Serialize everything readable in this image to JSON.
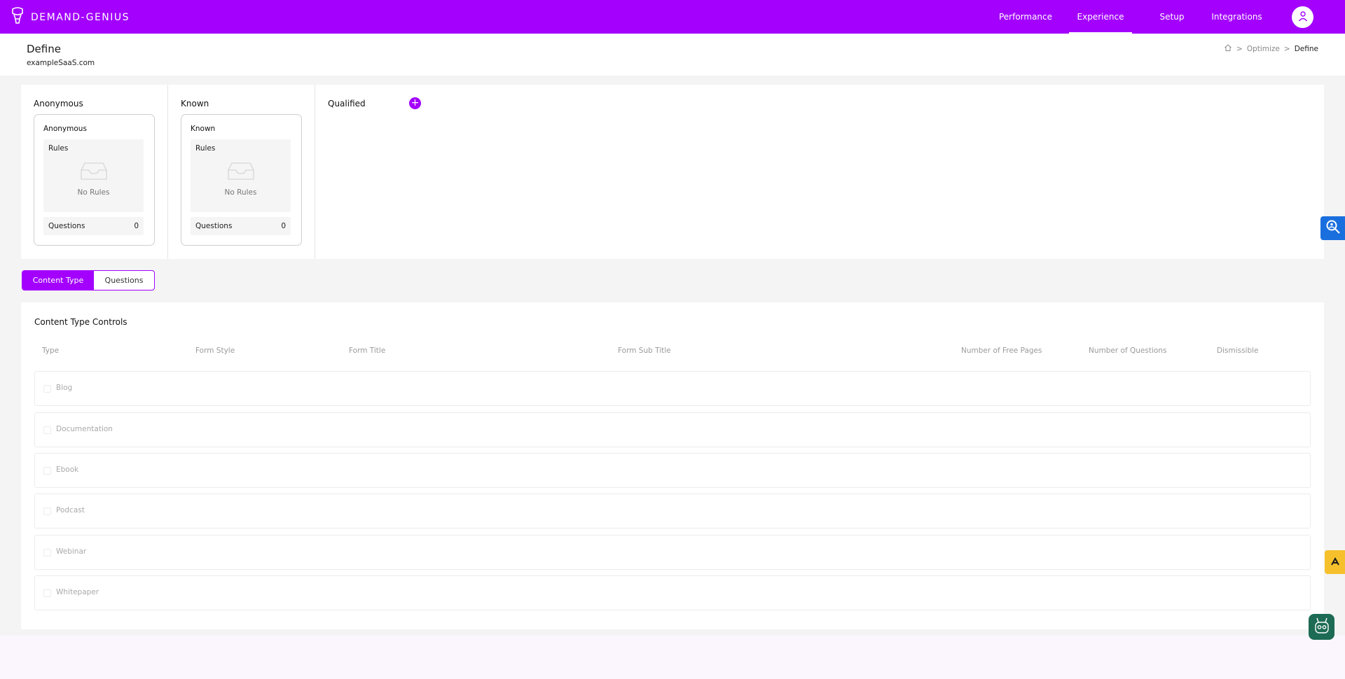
{
  "app": {
    "logo_text": "DEMAND-GENIUS"
  },
  "nav": {
    "items": [
      {
        "label": "Performance",
        "active": false
      },
      {
        "label": "Experience",
        "active": true
      },
      {
        "label": "Setup",
        "active": false
      },
      {
        "label": "Integrations",
        "active": false
      }
    ]
  },
  "header": {
    "title": "Define",
    "subtitle": "exampleSaaS.com",
    "breadcrumb": [
      "Optimize",
      "Define"
    ]
  },
  "segments": [
    {
      "heading": "Anonymous",
      "card_title": "Anonymous",
      "rules_label": "Rules",
      "empty_text": "No Rules",
      "questions_label": "Questions",
      "questions_count": "0"
    },
    {
      "heading": "Known",
      "card_title": "Known",
      "rules_label": "Rules",
      "empty_text": "No Rules",
      "questions_label": "Questions",
      "questions_count": "0"
    },
    {
      "heading": "Qualified"
    }
  ],
  "tabs": [
    {
      "label": "Content Type",
      "active": true
    },
    {
      "label": "Questions",
      "active": false
    }
  ],
  "controls": {
    "title": "Content Type Controls",
    "columns": [
      "Type",
      "Form Style",
      "Form Title",
      "Form Sub Title",
      "Number of Free Pages",
      "Number of Questions",
      "Dismissible"
    ],
    "rows": [
      "Blog",
      "Documentation",
      "Ebook",
      "Podcast",
      "Webinar",
      "Whitepaper"
    ]
  },
  "colors": {
    "brand": "#a300fe",
    "search_widget": "#1a6fde",
    "yellow_widget": "#f5c02c",
    "bot_widget": "#1d6b54"
  }
}
